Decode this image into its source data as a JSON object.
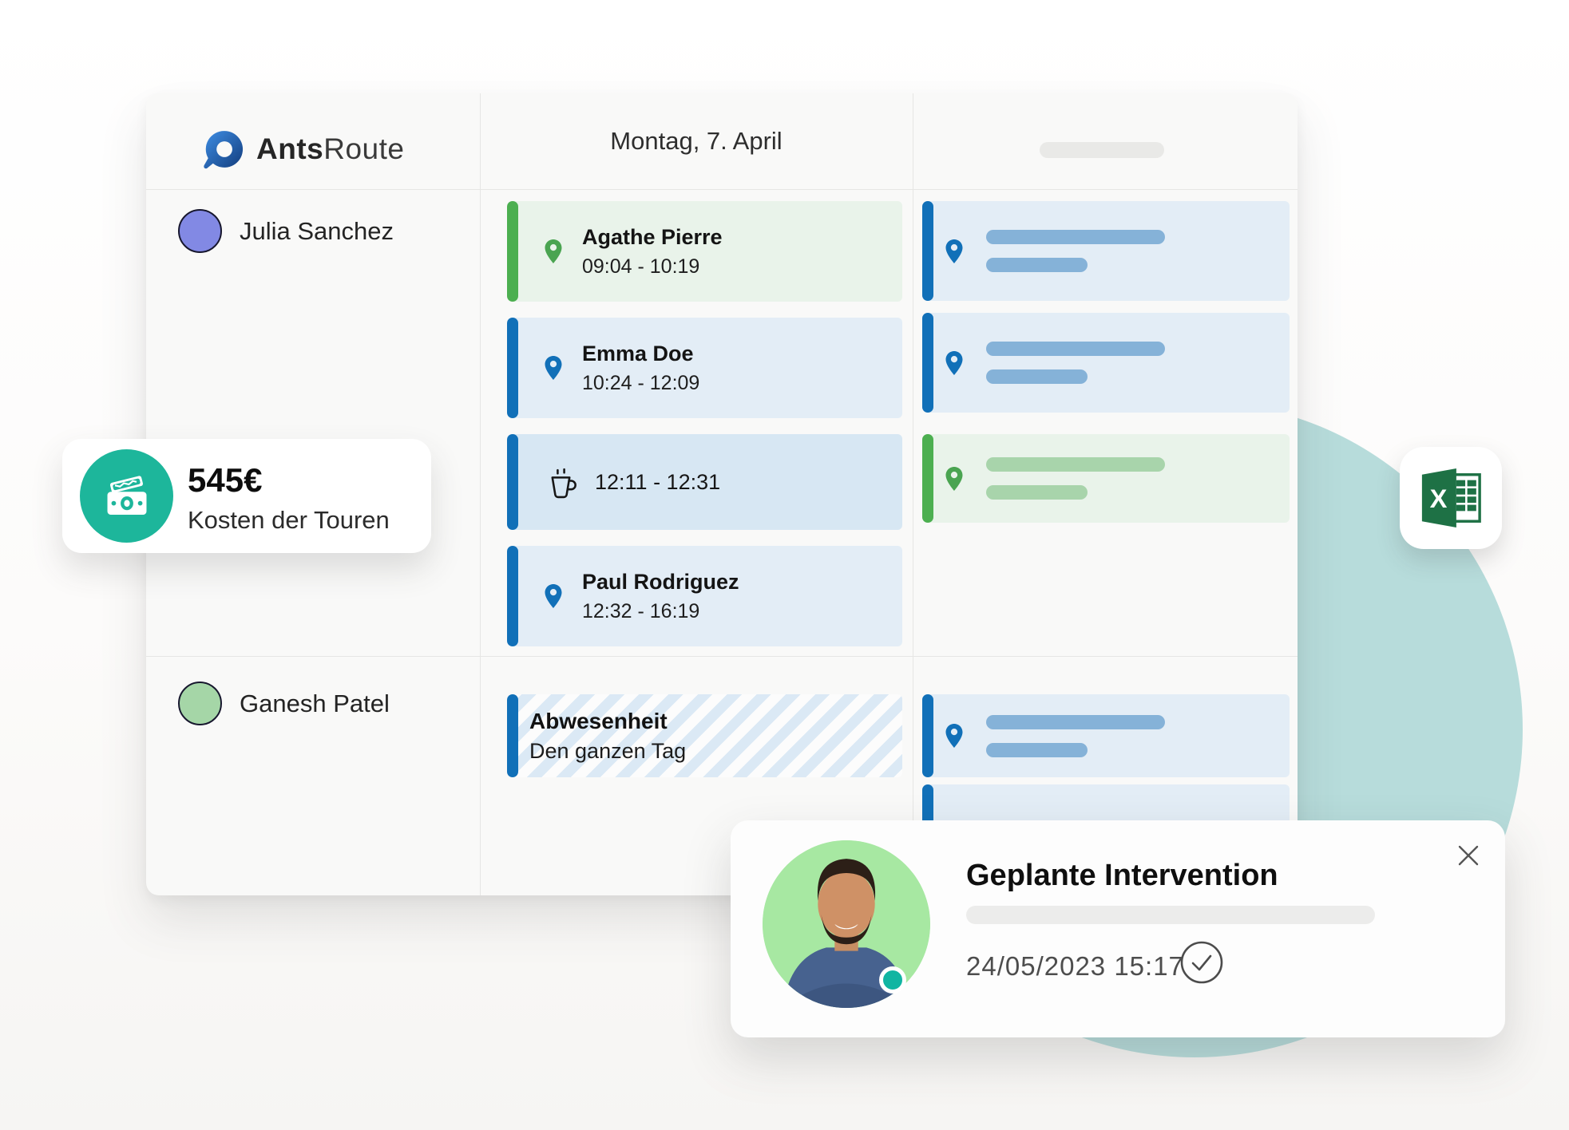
{
  "brand": {
    "name_bold": "Ants",
    "name_light": "Route"
  },
  "header": {
    "date_label": "Montag, 7. April"
  },
  "drivers": {
    "julia": {
      "name": "Julia Sanchez",
      "avatar_color": "#8289e4"
    },
    "ganesh": {
      "name": "Ganesh Patel",
      "avatar_color": "#a5d6a7"
    }
  },
  "events": {
    "agathe": {
      "name": "Agathe Pierre",
      "time": "09:04 - 10:19"
    },
    "emma": {
      "name": "Emma Doe",
      "time": "10:24 - 12:09"
    },
    "break": {
      "time": "12:11 - 12:31"
    },
    "paul": {
      "name": "Paul Rodriguez",
      "time": "12:32 - 16:19"
    },
    "absence": {
      "title": "Abwesenheit",
      "subtitle": "Den ganzen Tag"
    }
  },
  "cost_card": {
    "amount": "545€",
    "label": "Kosten der Touren"
  },
  "popup": {
    "title": "Geplante Intervention",
    "datetime": "24/05/2023 15:17"
  },
  "icons": {
    "logo": "antsroute-logo-icon",
    "visit": "location-pin-icon",
    "break": "coffee-cup-icon",
    "cost": "money-banknote-icon",
    "export": "excel-icon",
    "done": "check-circle-icon",
    "close": "close-icon"
  },
  "colors": {
    "green": "#4caf50",
    "green_bg": "#e9f3ea",
    "blue": "#1170b8",
    "blue_bg": "#e3edf6",
    "blue_bg_dark": "#d7e7f3",
    "skeleton_blue": "#85b2d8",
    "skeleton_green": "#a8d4ab",
    "teal_accent": "#1db69b",
    "teal_circle": "#b7dcdb",
    "excel_green": "#1e7145",
    "stripe_blue": "#dbe9f5"
  }
}
